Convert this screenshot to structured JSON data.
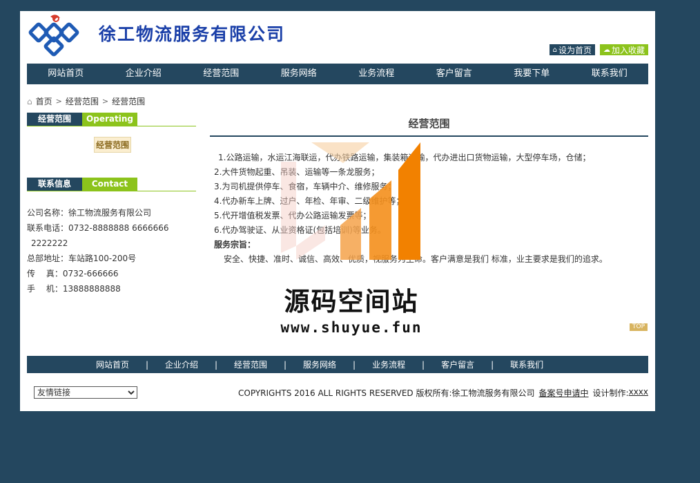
{
  "header": {
    "company_title": "徐工物流服务有限公司",
    "set_home_label": "设为首页",
    "add_favorite_label": "加入收藏",
    "accent_color": "#24475f",
    "green_color": "#8cc31c"
  },
  "main_nav": {
    "items": [
      "网站首页",
      "企业介绍",
      "经营范围",
      "服务网络",
      "业务流程",
      "客户留言",
      "我要下单",
      "联系我们"
    ]
  },
  "breadcrumb": {
    "items": [
      "首页",
      "经营范围",
      "经营范围"
    ]
  },
  "sidebar": {
    "category_box": {
      "cn": "经营范围",
      "en": "Operating"
    },
    "category_item": "经营范围",
    "contact_box": {
      "cn": "联系信息",
      "en": "Contact"
    },
    "contact": {
      "company": "公司名称：徐工物流服务有限公司",
      "phone": "联系电话：0732-8888888  6666666",
      "phone_cont": "2222222",
      "address": "总部地址：车站路100-200号",
      "fax": "传　 真：0732-666666",
      "mobile": "手　 机：13888888888"
    }
  },
  "content": {
    "title": "经营范围",
    "lines": [
      "1.公路运输，水运江海联运，代办铁路运输，集装箱运输，代办进出口货物运输，大型停车场，仓储；",
      "2.大件货物起重、吊装、运输等一条龙服务；",
      "3.为司机提供停车、食宿，车辆中介、维修服务；",
      "4.代办新车上牌、过户、年检、年审、二级维护等；",
      "5.代开增值税发票、代办公路运输发票等；",
      "6.代办驾驶证、从业资格证(包括培训)等业务。"
    ],
    "purpose_label": "服务宗旨：",
    "motto": "安全、快捷、准时、诚信、高效、优质，视服务为生命。客户满意是我们 标准，业主要求是我们的追求。"
  },
  "watermark": {
    "text": "源码空间站",
    "url": "www.shuyue.fun"
  },
  "top_label": "TOP",
  "footer_nav": {
    "items": [
      "网站首页",
      "企业介绍",
      "经营范围",
      "服务网络",
      "业务流程",
      "客户留言",
      "联系我们"
    ],
    "separator": "|"
  },
  "footer": {
    "friend_links_selected": "友情链接",
    "copyright": "COPYRIGHTS 2016  ALL RIGHTS RESERVED  版权所有:徐工物流服务有限公司",
    "icp_link": "备案号申请中",
    "design_label": "设计制作:",
    "design_link": "xxxx"
  }
}
